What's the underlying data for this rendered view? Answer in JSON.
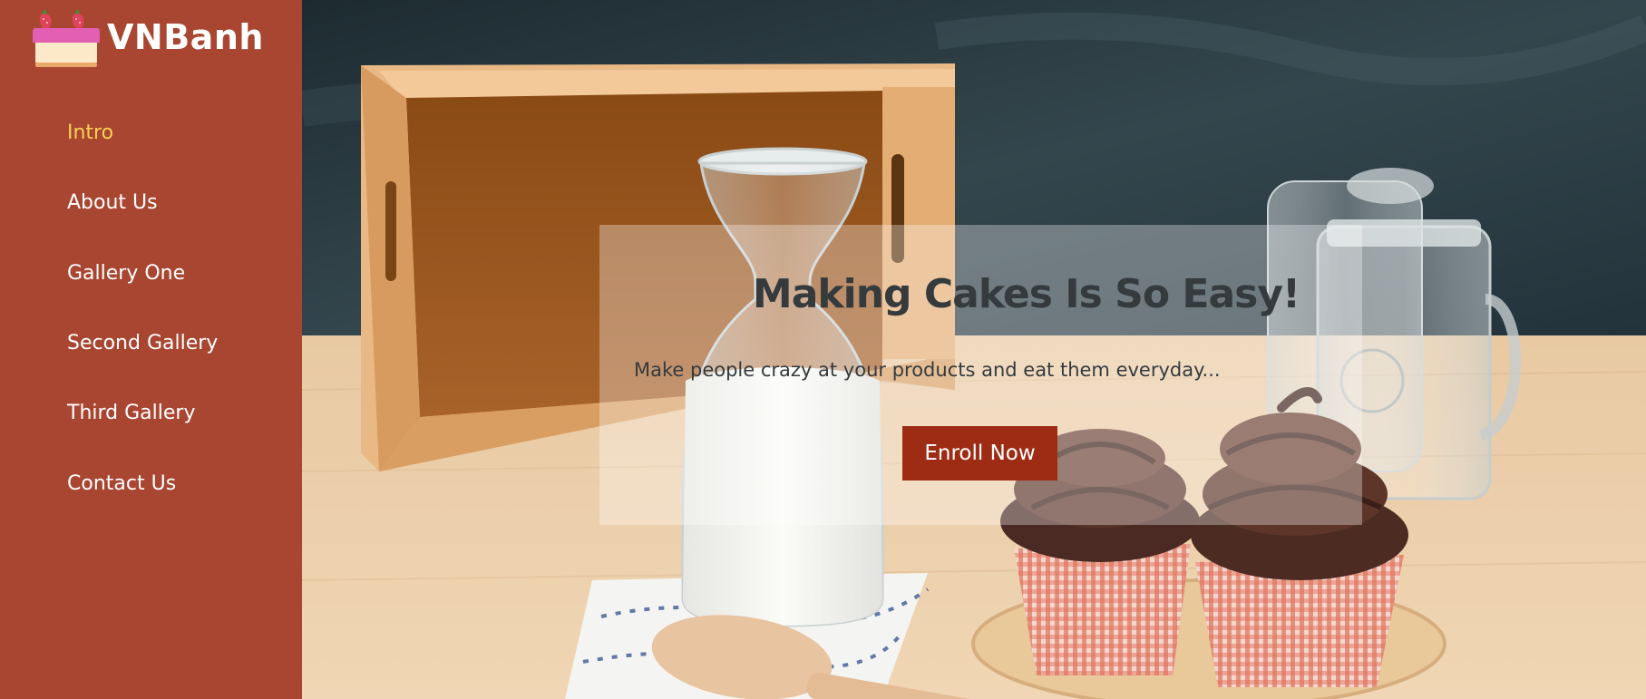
{
  "brand": {
    "name": "VNBanh",
    "logo_icon": "cake-with-strawberries-icon"
  },
  "nav": {
    "items": [
      {
        "label": "Intro",
        "active": true
      },
      {
        "label": "About Us",
        "active": false
      },
      {
        "label": "Gallery One",
        "active": false
      },
      {
        "label": "Second Gallery",
        "active": false
      },
      {
        "label": "Third Gallery",
        "active": false
      },
      {
        "label": "Contact Us",
        "active": false
      }
    ]
  },
  "hero": {
    "title": "Making Cakes Is So Easy!",
    "subtitle": "Make people crazy at your products and eat them everyday...",
    "cta_label": "Enroll Now",
    "background_image": "bakery-table-photo"
  },
  "colors": {
    "sidebar": "#a84631",
    "nav_active": "#f7d154",
    "cta": "#9e2c14",
    "heading": "#353a3d"
  }
}
